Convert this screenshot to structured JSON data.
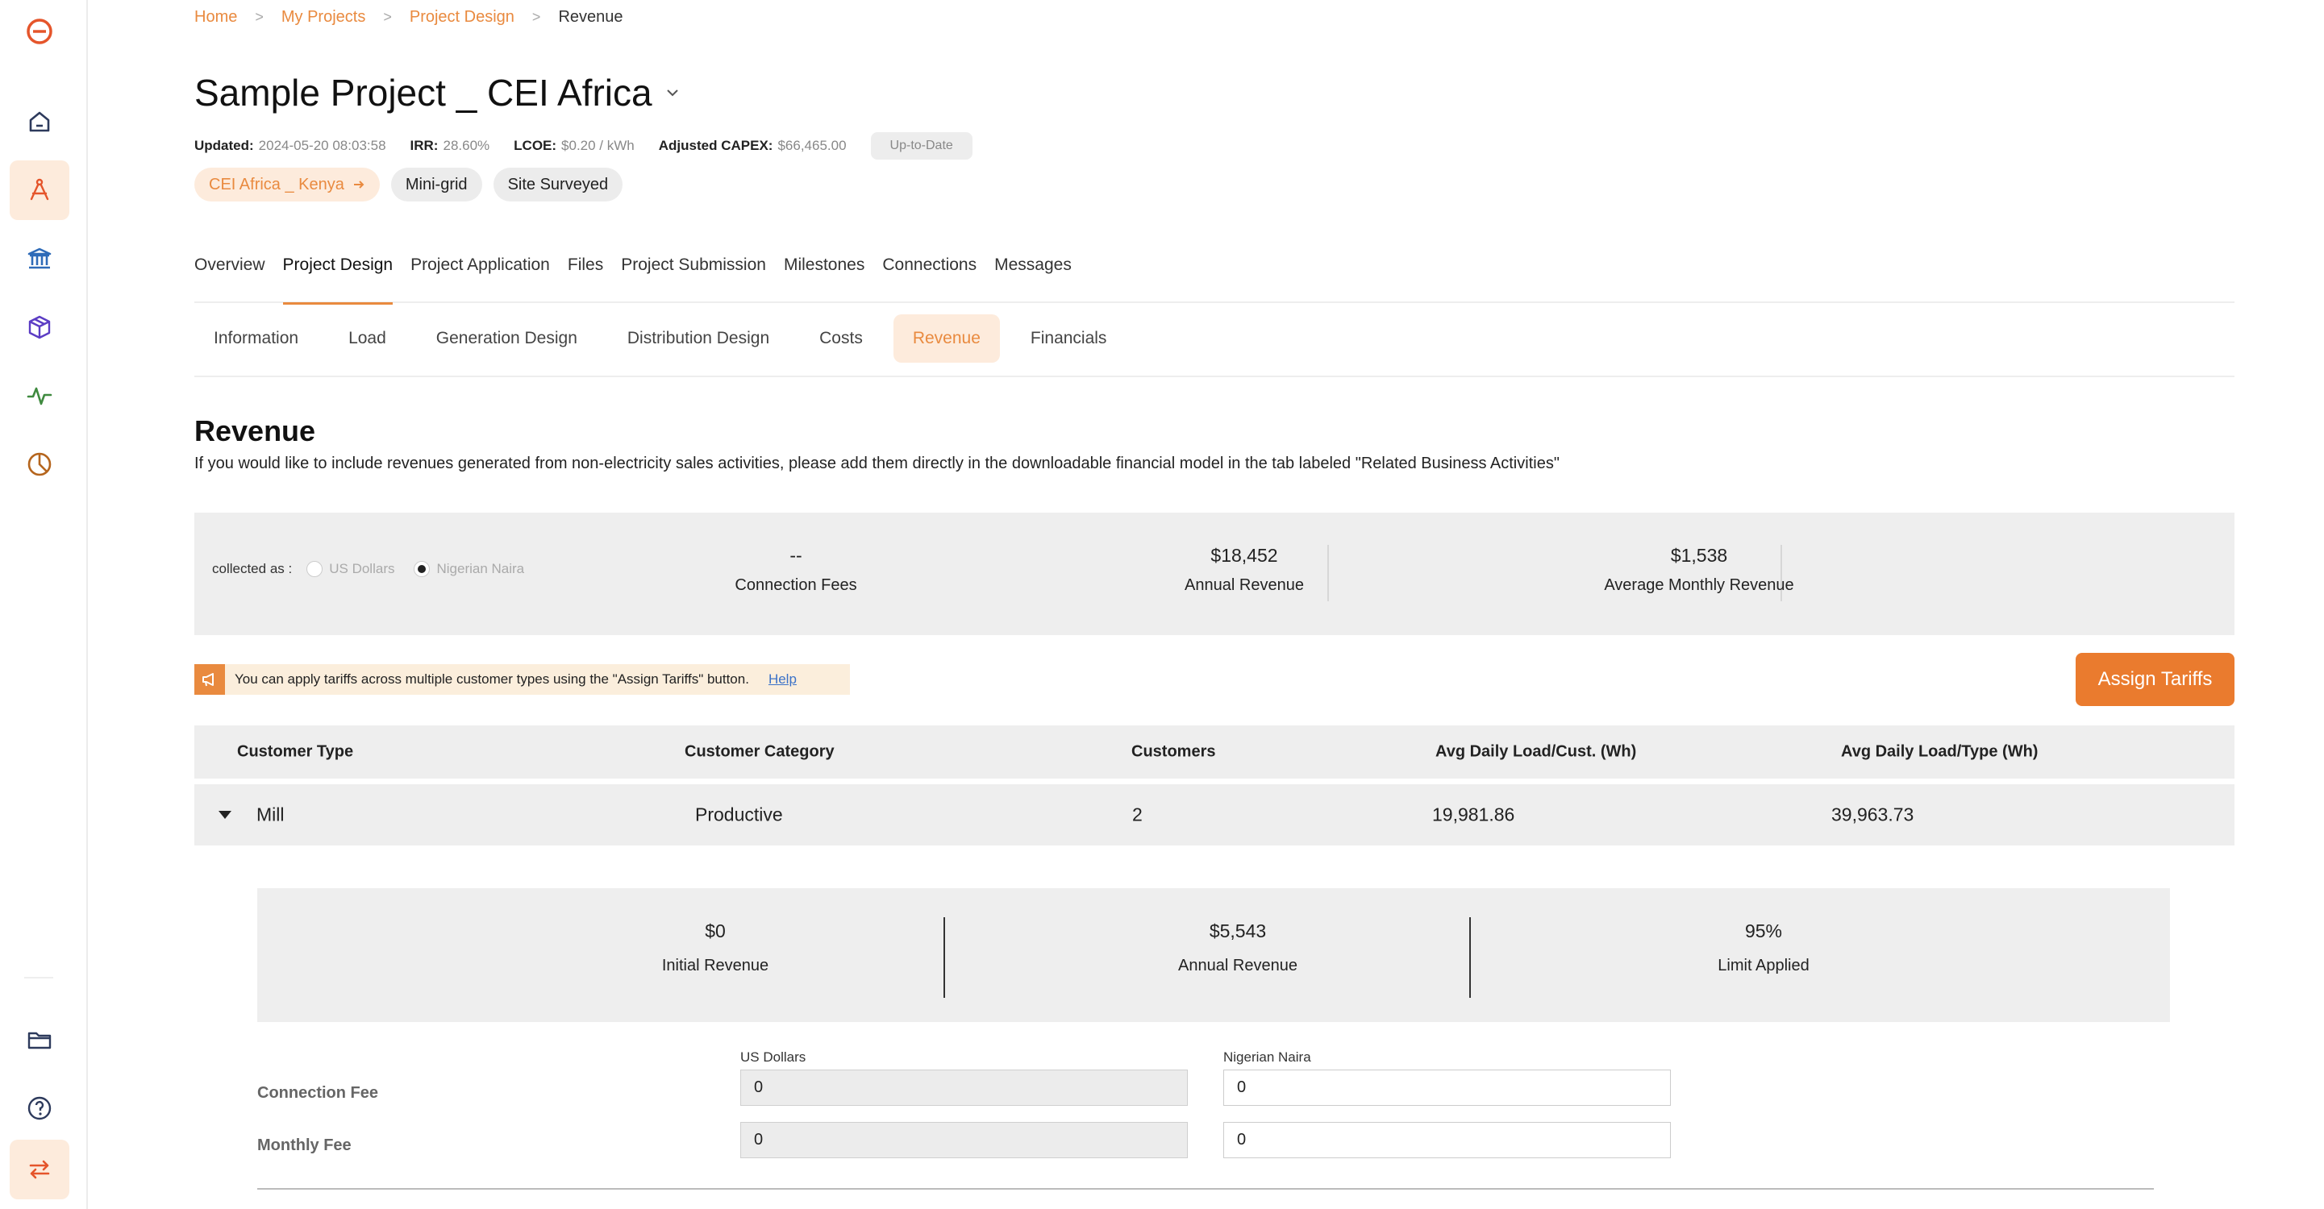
{
  "sidebar": {
    "items": [
      {
        "name": "logo-icon"
      },
      {
        "name": "home-icon"
      },
      {
        "name": "design-icon",
        "active": true
      },
      {
        "name": "bank-icon"
      },
      {
        "name": "box-icon"
      },
      {
        "name": "activity-icon"
      },
      {
        "name": "pie-chart-icon"
      },
      {
        "name": "folder-icon"
      },
      {
        "name": "help-icon"
      },
      {
        "name": "switch-icon",
        "active": true
      }
    ]
  },
  "breadcrumb": [
    "Home",
    "My Projects",
    "Project Design",
    "Revenue"
  ],
  "project": {
    "title": "Sample Project _ CEI Africa",
    "updated_label": "Updated:",
    "updated_value": "2024-05-20 08:03:58",
    "irr_label": "IRR:",
    "irr_value": "28.60%",
    "lcoe_label": "LCOE:",
    "lcoe_value": "$0.20 / kWh",
    "capex_label": "Adjusted CAPEX:",
    "capex_value": "$66,465.00",
    "status": "Up-to-Date",
    "tags": {
      "org": "CEI Africa _ Kenya",
      "type": "Mini-grid",
      "stage": "Site Surveyed"
    }
  },
  "tabs": [
    "Overview",
    "Project Design",
    "Project Application",
    "Files",
    "Project Submission",
    "Milestones",
    "Connections",
    "Messages"
  ],
  "subtabs": [
    "Information",
    "Load",
    "Generation Design",
    "Distribution Design",
    "Costs",
    "Revenue",
    "Financials"
  ],
  "revenue": {
    "title": "Revenue",
    "description": "If you would like to include revenues generated from non-electricity sales activities, please add them directly in the downloadable financial model in the tab labeled \"Related Business Activities\"",
    "collected_label": "collected as :",
    "currency_options": [
      "US Dollars",
      "Nigerian Naira"
    ],
    "selected_currency": "Nigerian Naira",
    "connection_fees_value": "--",
    "connection_fees_label": "Connection Fees",
    "annual_revenue_value": "$18,452",
    "annual_revenue_label": "Annual Revenue",
    "avg_monthly_value": "$1,538",
    "avg_monthly_label": "Average Monthly Revenue",
    "hint": "You can apply tariffs across multiple customer types using the \"Assign Tariffs\" button.",
    "help_link": "Help",
    "assign_button": "Assign Tariffs"
  },
  "table": {
    "headers": [
      "Customer Type",
      "Customer Category",
      "Customers",
      "Avg Daily Load/Cust. (Wh)",
      "Avg Daily Load/Type (Wh)"
    ],
    "rows": [
      {
        "type": "Mill",
        "category": "Productive",
        "customers": "2",
        "load_per_cust": "19,981.86",
        "load_per_type": "39,963.73"
      }
    ]
  },
  "detail": {
    "initial_revenue_value": "$0",
    "initial_revenue_label": "Initial Revenue",
    "annual_revenue_value": "$5,543",
    "annual_revenue_label": "Annual Revenue",
    "limit_value": "95%",
    "limit_label": "Limit Applied",
    "col_usd": "US Dollars",
    "col_ngn": "Nigerian Naira",
    "connection_fee_label": "Connection Fee",
    "monthly_fee_label": "Monthly Fee",
    "connection_fee_usd": "0",
    "connection_fee_ngn": "0",
    "monthly_fee_usd": "0",
    "monthly_fee_ngn": "0"
  },
  "colors": {
    "accent": "#ea7b2e",
    "accent_light": "#fdebdc",
    "panel": "#eeeeee"
  }
}
